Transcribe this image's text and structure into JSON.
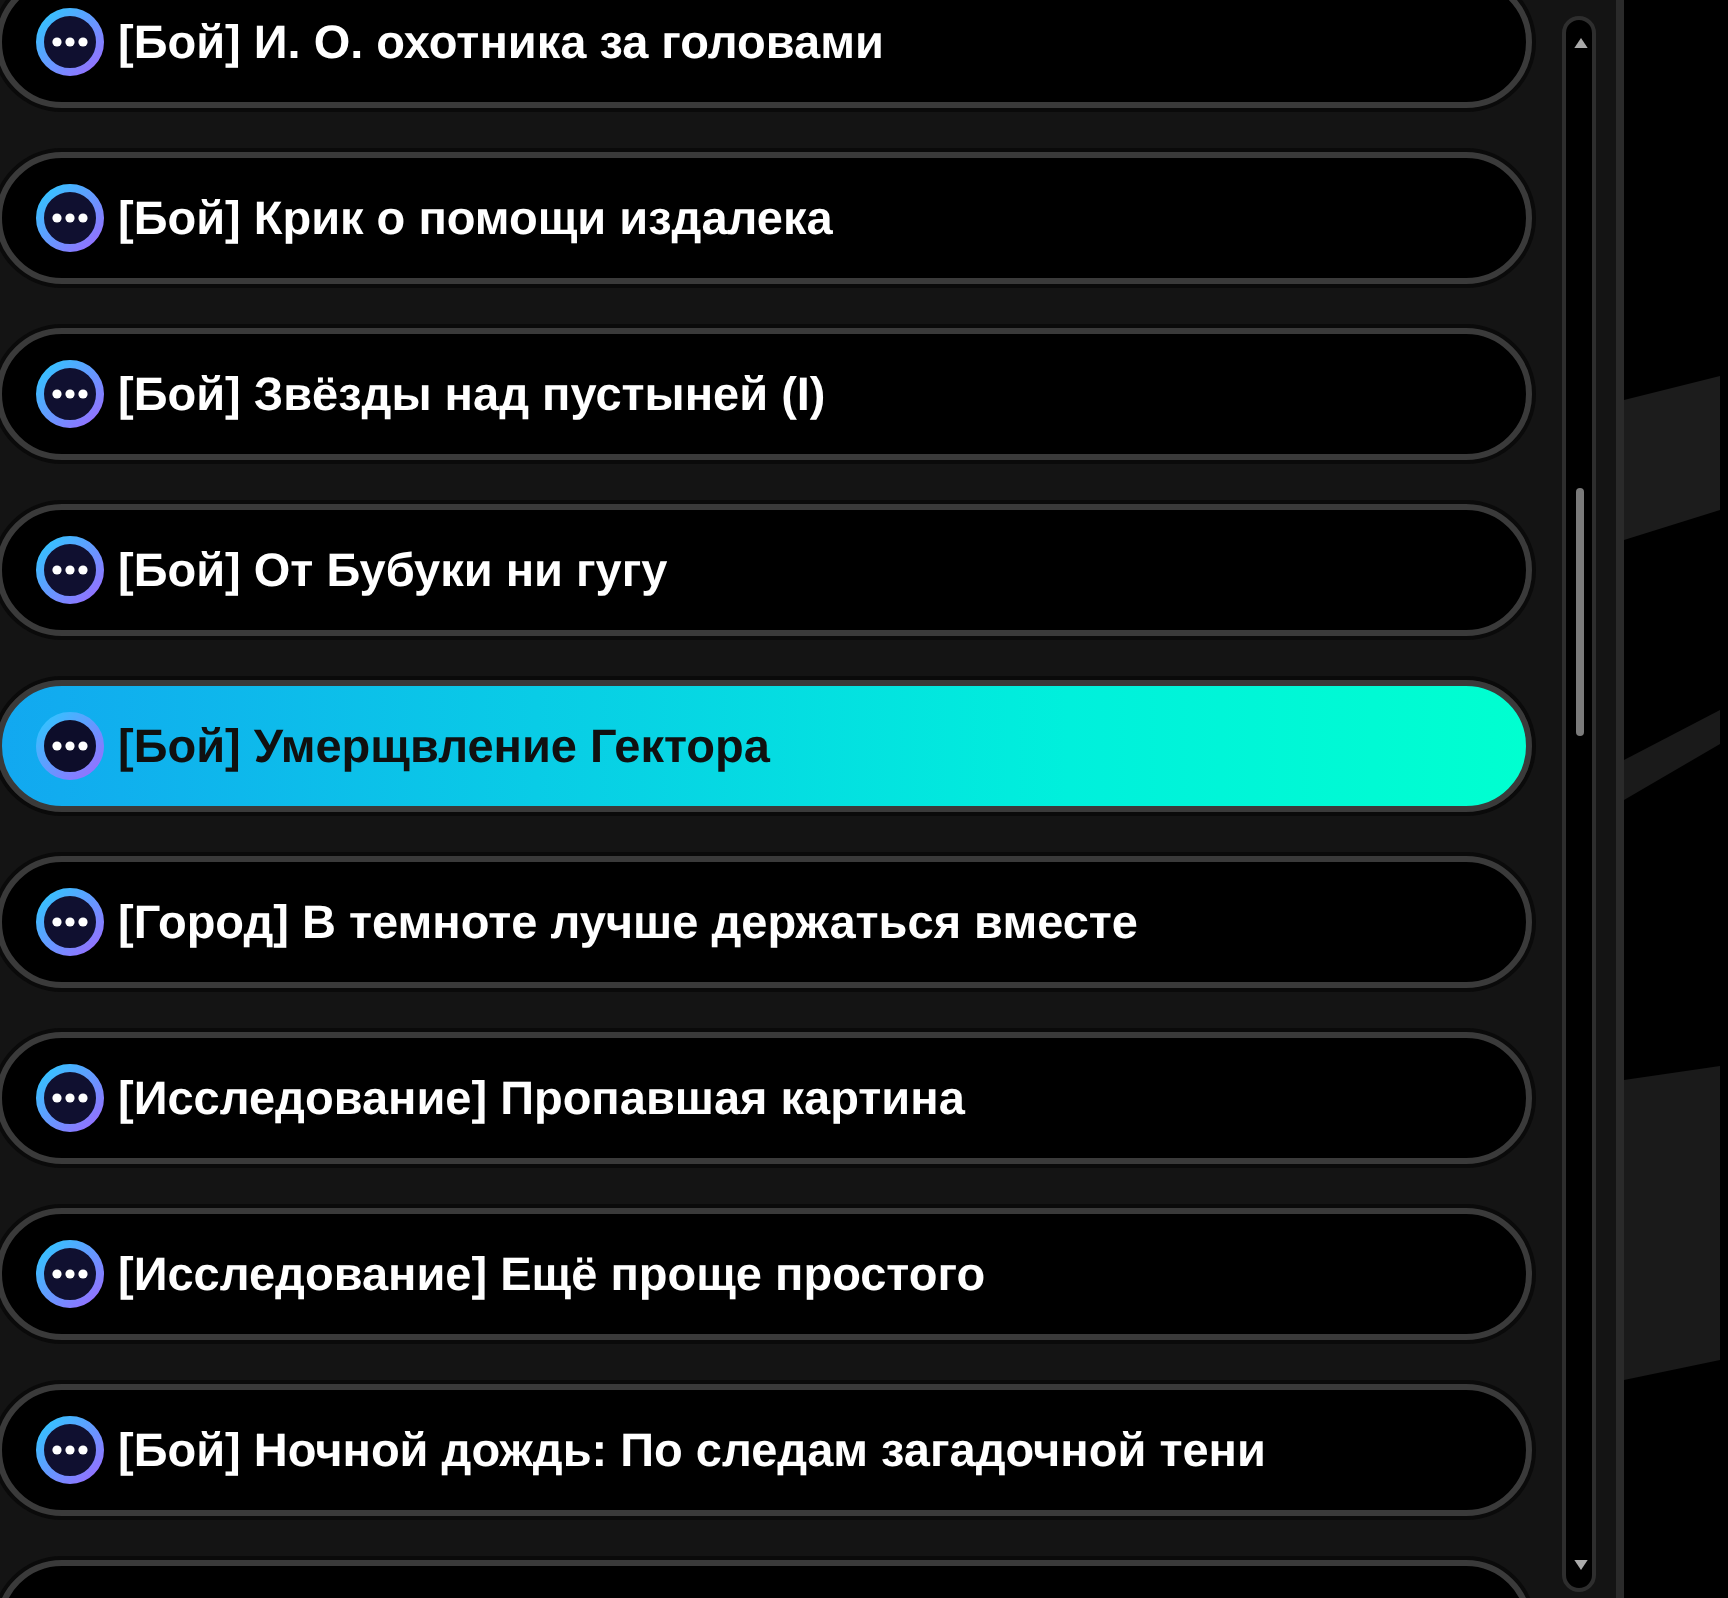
{
  "quests": [
    {
      "title": "[Бой] И. О. охотника за головами",
      "selected": false
    },
    {
      "title": "[Бой] Крик о помощи издалека",
      "selected": false
    },
    {
      "title": "[Бой] Звёзды над пустыней (I)",
      "selected": false
    },
    {
      "title": "[Бой] От Бубуки ни гугу",
      "selected": false
    },
    {
      "title": "[Бой] Умерщвление Гектора",
      "selected": true
    },
    {
      "title": "[Город] В темноте лучше держаться вместе",
      "selected": false
    },
    {
      "title": "[Исследование] Пропавшая картина",
      "selected": false
    },
    {
      "title": "[Исследование] Ещё проще простого",
      "selected": false
    },
    {
      "title": "[Бой] Ночной дождь: По следам загадочной тени",
      "selected": false
    }
  ]
}
